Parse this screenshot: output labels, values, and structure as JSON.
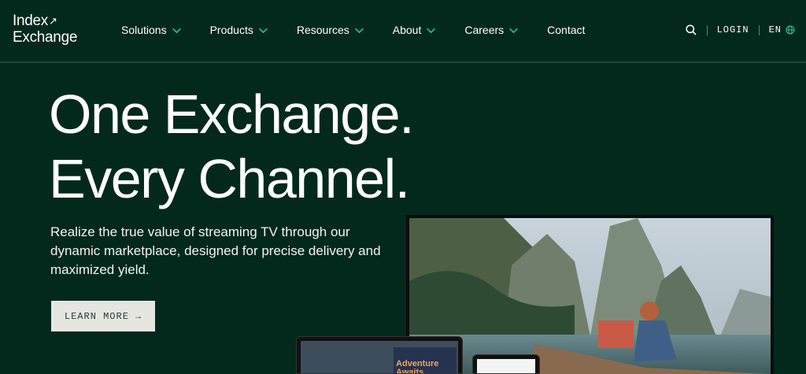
{
  "header": {
    "logo": {
      "line1": "Index",
      "line2": "Exchange"
    },
    "nav": [
      {
        "label": "Solutions",
        "has_dropdown": true
      },
      {
        "label": "Products",
        "has_dropdown": true
      },
      {
        "label": "Resources",
        "has_dropdown": true
      },
      {
        "label": "About",
        "has_dropdown": true
      },
      {
        "label": "Careers",
        "has_dropdown": true
      },
      {
        "label": "Contact",
        "has_dropdown": false
      }
    ],
    "login_label": "LOGIN",
    "language_label": "EN",
    "icons": {
      "search": "search-icon",
      "language": "globe-icon",
      "dropdown": "chevron-down-icon"
    }
  },
  "hero": {
    "title_line1": "One Exchange.",
    "title_line2": "Every Channel.",
    "subtitle": "Realize the true value of streaming TV through our dynamic marketplace, designed for precise delivery and maximized yield.",
    "cta_label": "LEARN MORE",
    "cta_arrow": "→"
  },
  "devices": {
    "tablet_card_text": "Adventure Awaits"
  },
  "colors": {
    "background": "#03291d",
    "accent": "#2fc4a0",
    "text": "#ffffff",
    "button_bg": "#e6e6e1",
    "button_text": "#253a32"
  }
}
